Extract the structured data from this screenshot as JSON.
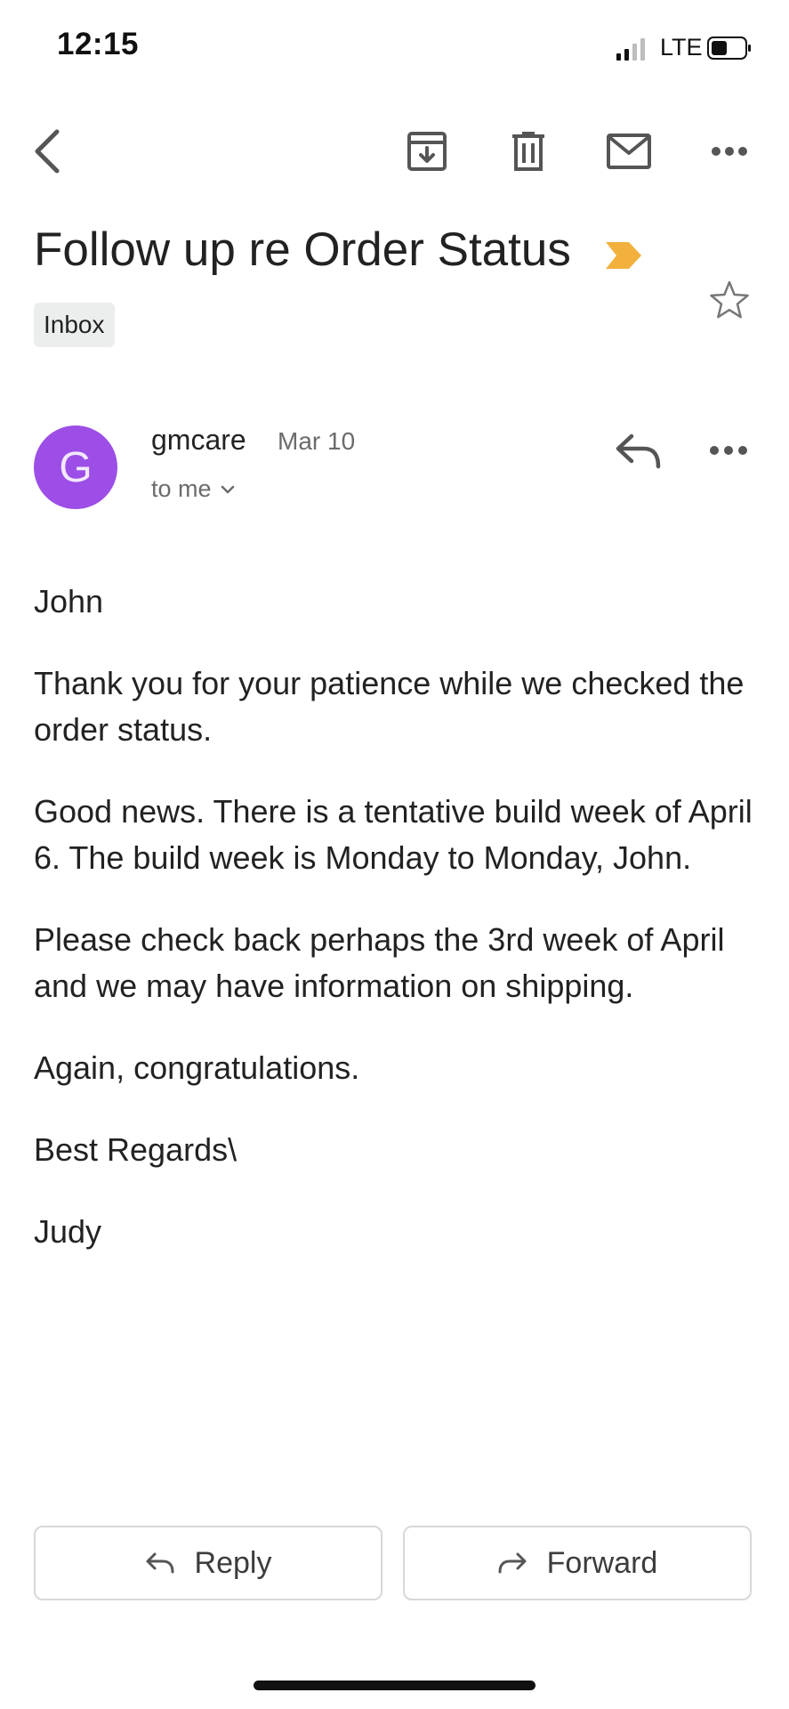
{
  "status_bar": {
    "time": "12:15",
    "network": "LTE"
  },
  "toolbar": {
    "back_icon": "chevron-left-icon",
    "archive_icon": "archive-icon",
    "delete_icon": "trash-icon",
    "mark_unread_icon": "mail-icon",
    "more_icon": "more-horizontal-icon"
  },
  "email": {
    "subject": "Follow up re Order Status",
    "label": "Inbox",
    "importance_color": "#f2b13c",
    "sender": {
      "avatar_letter": "G",
      "avatar_color": "#9c4ee6",
      "name": "gmcare",
      "date": "Mar 10",
      "recipient": "to me"
    },
    "body": [
      "John",
      "Thank you for your patience while we checked the order status.",
      "Good news. There is a tentative build week of April 6. The build week is Monday to Monday, John.",
      "Please check back perhaps the 3rd week of April and we may have information on shipping.",
      "Again, congratulations.",
      "Best Regards\\",
      "Judy"
    ]
  },
  "actions": {
    "reply_label": "Reply",
    "forward_label": "Forward"
  }
}
